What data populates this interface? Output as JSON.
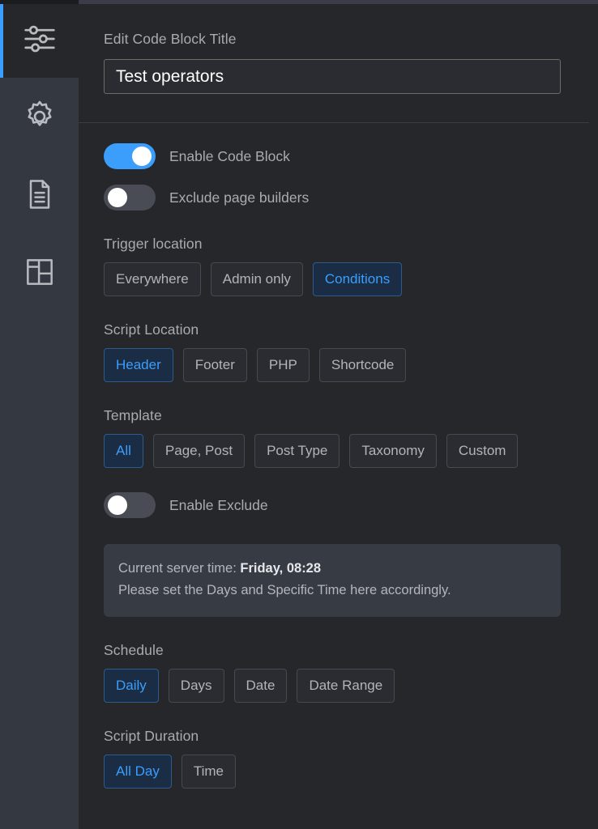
{
  "theme": {
    "accent": "#3b9dfc",
    "sidebar_bg": "#343841",
    "content_bg": "#26272b",
    "panel_bg": "#373b44",
    "label_color": "#a9abb0"
  },
  "sidebar": {
    "items": [
      {
        "icon": "sliders-icon",
        "name": "sidebar-item-settings-sliders",
        "active": true
      },
      {
        "icon": "gear-icon",
        "name": "sidebar-item-gear",
        "active": false
      },
      {
        "icon": "document-icon",
        "name": "sidebar-item-document",
        "active": false
      },
      {
        "icon": "layout-icon",
        "name": "sidebar-item-layout",
        "active": false
      }
    ]
  },
  "title_section": {
    "label": "Edit Code Block Title",
    "input_value": "Test operators",
    "input_placeholder": "Edit Code Block Title"
  },
  "toggles": [
    {
      "label": "Enable Code Block",
      "on": true
    },
    {
      "label": "Exclude page builders",
      "on": false
    }
  ],
  "trigger_location": {
    "label": "Trigger location",
    "options": [
      {
        "label": "Everywhere",
        "active": false
      },
      {
        "label": "Admin only",
        "active": false
      },
      {
        "label": "Conditions",
        "active": true
      }
    ]
  },
  "script_location": {
    "label": "Script Location",
    "options": [
      {
        "label": "Header",
        "active": true
      },
      {
        "label": "Footer",
        "active": false
      },
      {
        "label": "PHP",
        "active": false
      },
      {
        "label": "Shortcode",
        "active": false
      }
    ]
  },
  "template": {
    "label": "Template",
    "options": [
      {
        "label": "All",
        "active": true
      },
      {
        "label": "Page, Post",
        "active": false
      },
      {
        "label": "Post Type",
        "active": false
      },
      {
        "label": "Taxonomy",
        "active": false
      },
      {
        "label": "Custom",
        "active": false
      }
    ]
  },
  "exclude_toggle": {
    "label": "Enable Exclude",
    "on": false
  },
  "server_time_notice": {
    "line1_prefix": "Current server time: ",
    "line1_value": "Friday, 08:28",
    "line2": "Please set the Days and Specific Time here accordingly."
  },
  "schedule": {
    "label": "Schedule",
    "options": [
      {
        "label": "Daily",
        "active": true
      },
      {
        "label": "Days",
        "active": false
      },
      {
        "label": "Date",
        "active": false
      },
      {
        "label": "Date Range",
        "active": false
      }
    ]
  },
  "script_duration": {
    "label": "Script Duration",
    "options": [
      {
        "label": "All Day",
        "active": true
      },
      {
        "label": "Time",
        "active": false
      }
    ]
  }
}
